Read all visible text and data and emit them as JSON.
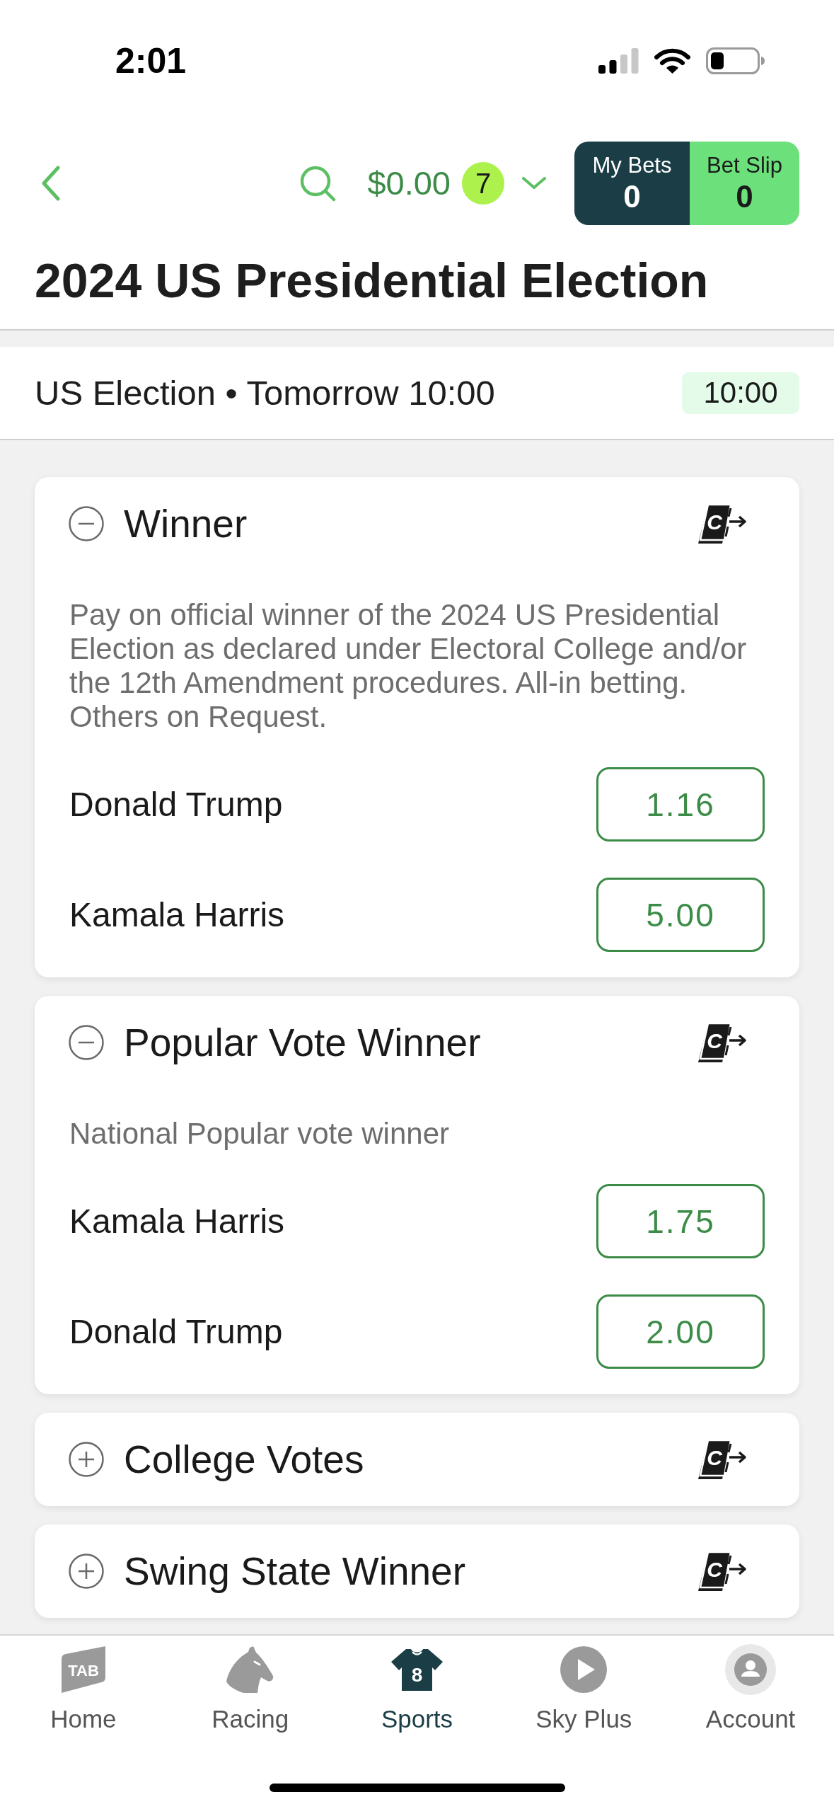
{
  "status_bar": {
    "time": "2:01"
  },
  "header": {
    "balance": "$0.00",
    "badge": "7",
    "my_bets": {
      "label": "My Bets",
      "count": "0"
    },
    "bet_slip": {
      "label": "Bet Slip",
      "count": "0"
    }
  },
  "title": "2024 US Presidential Election",
  "event": {
    "info": "US Election • Tomorrow 10:00",
    "time": "10:00"
  },
  "markets": [
    {
      "name": "Winner",
      "expanded": true,
      "cash_out_letter": "C",
      "description": "Pay on official winner of the 2024 US Presidential Election as declared under Electoral College and/or the 12th Amendment procedures. All-in betting. Others on Request.",
      "selections": [
        {
          "name": "Donald Trump",
          "odds": "1.16"
        },
        {
          "name": "Kamala Harris",
          "odds": "5.00"
        }
      ]
    },
    {
      "name": "Popular Vote Winner",
      "expanded": true,
      "cash_out_letter": "C",
      "description": "National Popular vote winner",
      "selections": [
        {
          "name": "Kamala Harris",
          "odds": "1.75"
        },
        {
          "name": "Donald Trump",
          "odds": "2.00"
        }
      ]
    },
    {
      "name": "College Votes",
      "expanded": false,
      "cash_out_letter": "C"
    },
    {
      "name": "Swing State Winner",
      "expanded": false,
      "cash_out_letter": "C"
    }
  ],
  "tab_bar": [
    {
      "label": "Home",
      "kind": "logo",
      "logo_text": "TAB",
      "selected": false
    },
    {
      "label": "Racing",
      "kind": "horse",
      "selected": false
    },
    {
      "label": "Sports",
      "kind": "jersey",
      "jersey_number": "8",
      "selected": true
    },
    {
      "label": "Sky Plus",
      "kind": "play",
      "selected": false
    },
    {
      "label": "Account",
      "kind": "account",
      "selected": false
    }
  ]
}
